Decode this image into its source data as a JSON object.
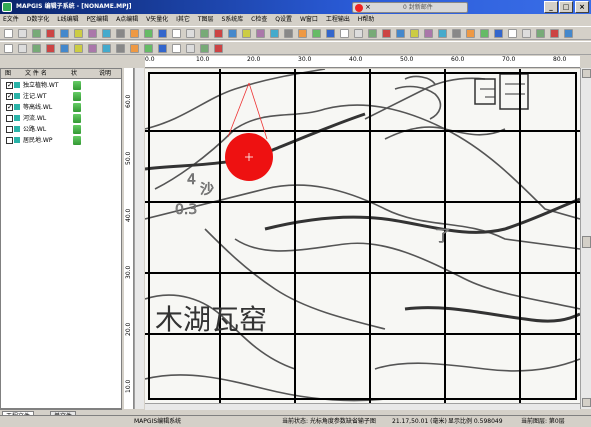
{
  "window": {
    "title": "MAPGIS 编辑子系统 - [NONAME.MPJ]",
    "min": "_",
    "max": "□",
    "close": "×"
  },
  "notification": {
    "text": "0 封新邮件",
    "close": "×"
  },
  "menu": [
    "E文件",
    "D数字化",
    "L线编辑",
    "P区编辑",
    "A点编辑",
    "V矢量化",
    "I其它",
    "T图层",
    "S系统库",
    "C检查",
    "Q设置",
    "W窗口",
    "工程输出",
    "H帮助"
  ],
  "left_panel": {
    "headers": [
      "图",
      "文 件 名",
      "状",
      "说明"
    ],
    "layers": [
      {
        "name": "独立植物.WT",
        "checked": true
      },
      {
        "name": "注记.WT",
        "checked": true
      },
      {
        "name": "等高线.WL",
        "checked": true
      },
      {
        "name": "河流.WL",
        "checked": false
      },
      {
        "name": "公路.WL",
        "checked": false
      },
      {
        "name": "居民地.WP",
        "checked": false
      }
    ]
  },
  "bottom_tabs": [
    "工程文件",
    "单文件"
  ],
  "ruler_top": [
    "0.0",
    "10.0",
    "20.0",
    "30.0",
    "40.0",
    "50.0",
    "60.0",
    "70.0",
    "80.0"
  ],
  "ruler_left": [
    "60.0",
    "50.0",
    "40.0",
    "30.0",
    "20.0",
    "10.0"
  ],
  "map": {
    "label_big": "木湖瓦窑",
    "label_small_1": "4",
    "label_small_2": "沙",
    "label_small_3": "0.3",
    "label_small_4": "了"
  },
  "status": {
    "app": "MAPGIS编辑系统",
    "state": "当前状态: 光标角度参数缺省输子图",
    "coords": "21.17,50.01 (毫米)",
    "scale": "显示比例 0.598049",
    "layer": "当前图层: 第0层"
  },
  "colors": {
    "title_start": "#0a246a",
    "title_end": "#3a6ee8",
    "cursor_circle": "#ee1111"
  }
}
